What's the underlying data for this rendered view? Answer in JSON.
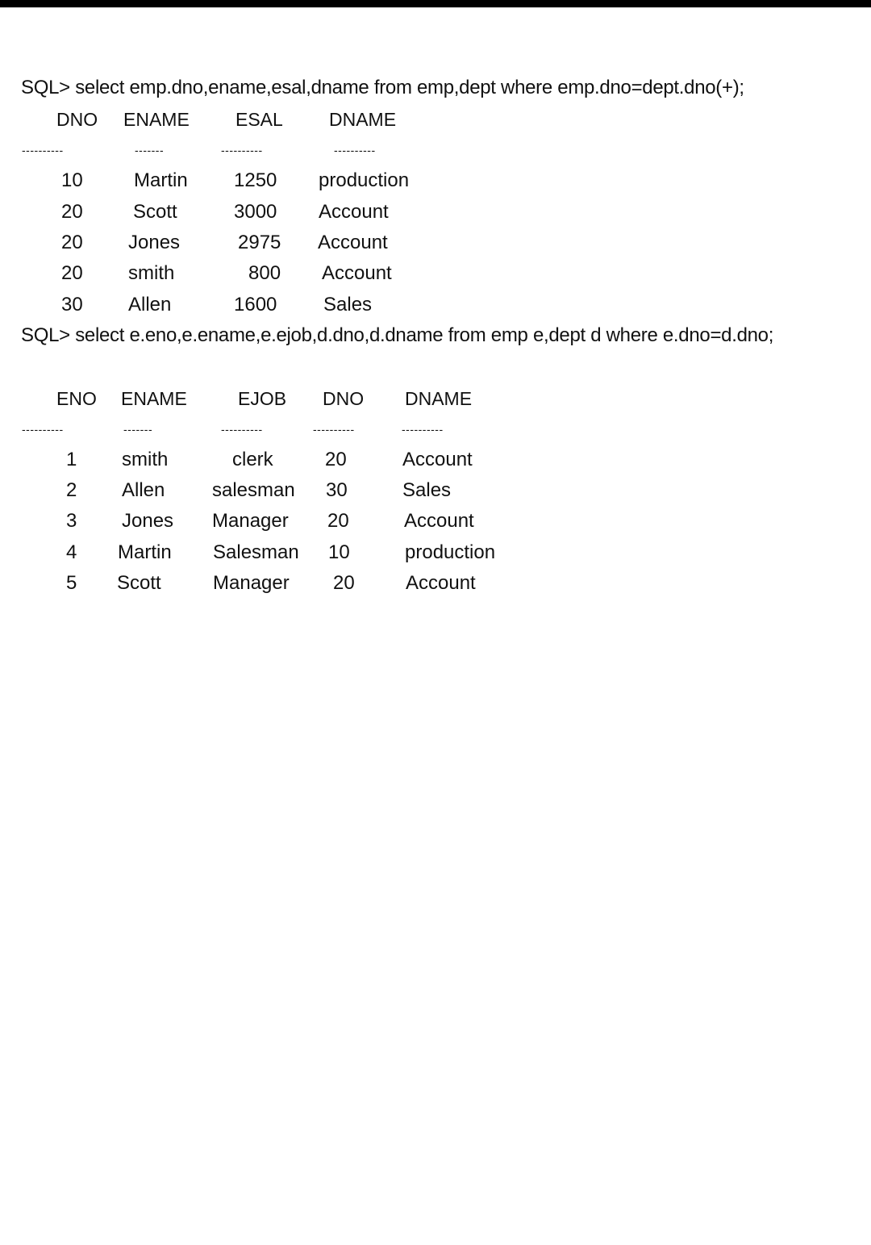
{
  "queries": [
    {
      "prompt_text": "SQL> select emp.dno,ename,esal,dname from emp,dept where emp.dno=dept.dno(+);",
      "columns": [
        "DNO",
        "ENAME",
        "ESAL",
        "DNAME"
      ],
      "separators": [
        "----------",
        "-------",
        "----------",
        "----------"
      ],
      "rows": [
        [
          "10",
          "Martin",
          "1250",
          "production"
        ],
        [
          "20",
          "Scott",
          "3000",
          "Account"
        ],
        [
          "20",
          "Jones",
          "2975",
          "Account"
        ],
        [
          "20",
          "smith",
          "800",
          "Account"
        ],
        [
          "30",
          "Allen",
          "1600",
          "Sales"
        ]
      ]
    },
    {
      "prompt_text": "SQL> select e.eno,e.ename,e.ejob,d.dno,d.dname from emp e,dept d where e.dno=d.dno;",
      "columns": [
        "ENO",
        "ENAME",
        "EJOB",
        "DNO",
        "DNAME"
      ],
      "separators": [
        "----------",
        "-------",
        "----------",
        "----------",
        "----------"
      ],
      "rows": [
        [
          "1",
          "smith",
          "clerk",
          "20",
          "Account"
        ],
        [
          "2",
          "Allen",
          "salesman",
          "30",
          "Sales"
        ],
        [
          "3",
          "Jones",
          "Manager",
          "20",
          "Account"
        ],
        [
          "4",
          "Martin",
          "Salesman",
          "10",
          "production"
        ],
        [
          "5",
          "Scott",
          "Manager",
          "20",
          "Account"
        ]
      ]
    }
  ]
}
